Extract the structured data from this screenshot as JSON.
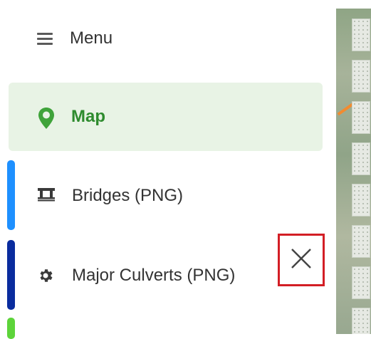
{
  "menu": {
    "title": "Menu",
    "icon": "hamburger-icon"
  },
  "items": [
    {
      "label": "Map",
      "icon": "map-pin-icon",
      "active": true,
      "color": "#2e8b2e"
    },
    {
      "label": "Bridges (PNG)",
      "icon": "bridge-icon",
      "accent": "#1e90ff"
    },
    {
      "label": "Major Culverts (PNG)",
      "icon": "gear-icon",
      "accent": "#0a2c9e"
    }
  ],
  "close_button": {
    "icon": "close-icon",
    "highlight": "#d31e25"
  }
}
